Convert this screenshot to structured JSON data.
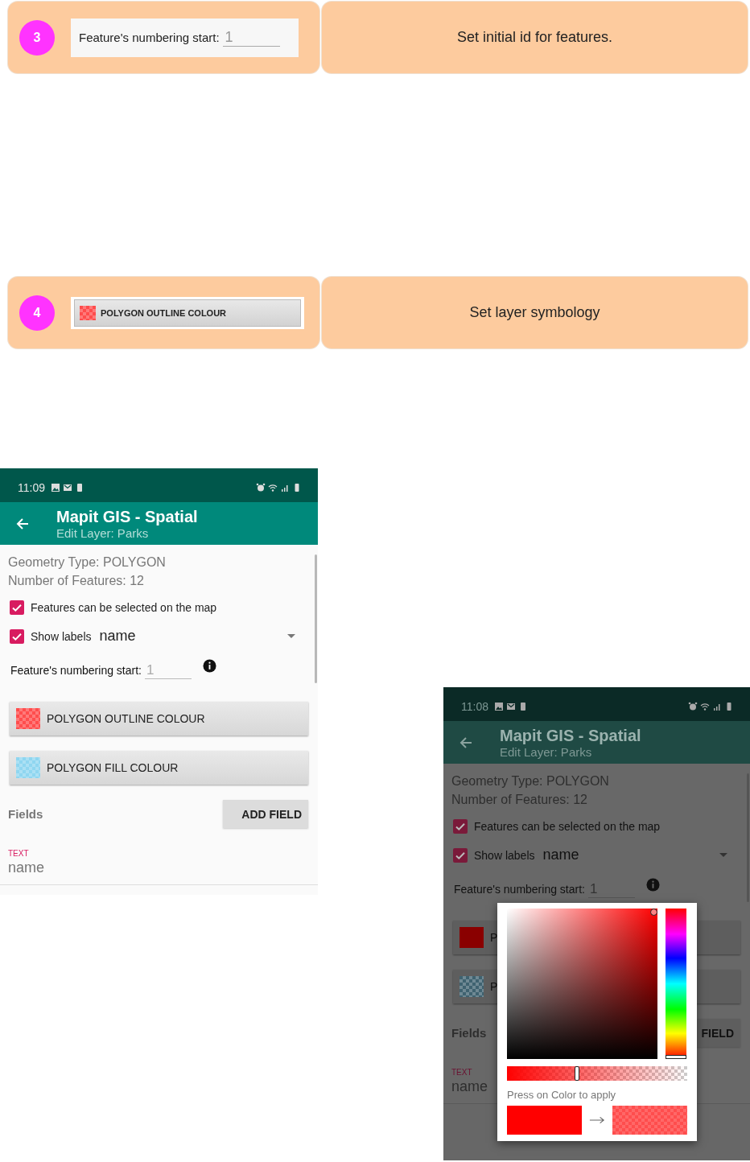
{
  "steps": [
    {
      "number": "3",
      "kind": "numbering",
      "label": "Feature's numbering start:",
      "placeholder": "1",
      "description": "Set initial id for features."
    },
    {
      "number": "4",
      "kind": "colour_button",
      "label": "POLYGON OUTLINE COLOUR",
      "color": "#ff4d4d",
      "description": "Set layer symbology"
    }
  ],
  "phones": [
    {
      "dimmed": false,
      "time": "11:09",
      "title": "Mapit GIS - Spatial",
      "subtitle": "Edit Layer: Parks",
      "info": [
        "Geometry Type: POLYGON",
        "Number of Features: 12"
      ],
      "checkboxes": [
        {
          "label": "Features can be selected on the map",
          "checked": true
        },
        {
          "label": "Show labels",
          "checked": true,
          "value": "name"
        }
      ],
      "numbering": {
        "label": "Feature's numbering start:",
        "placeholder": "1"
      },
      "colour_buttons": [
        {
          "label": "POLYGON OUTLINE COLOUR",
          "color": "#ff4d4d",
          "pattern": true
        },
        {
          "label": "POLYGON FILL COLOUR",
          "color": "#8fd6f0",
          "pattern": true
        }
      ],
      "fields_heading": "Fields",
      "add_field_button": "ADD FIELD",
      "field": {
        "type": "TEXT",
        "name": "name"
      }
    },
    {
      "dimmed": true,
      "time": "11:08",
      "title": "Mapit GIS - Spatial",
      "subtitle": "Edit Layer: Parks",
      "info": [
        "Geometry Type: POLYGON",
        "Number of Features: 12"
      ],
      "checkboxes": [
        {
          "label": "Features can be selected on the map",
          "checked": true
        },
        {
          "label": "Show labels",
          "checked": true,
          "value": "name"
        }
      ],
      "numbering": {
        "label": "Feature's numbering start:",
        "placeholder": "1"
      },
      "colour_buttons": [
        {
          "label": "P",
          "color": "#8a0000",
          "pattern": false
        },
        {
          "label": "P",
          "color": "#3f6270",
          "pattern": true
        }
      ],
      "fields_heading": "Fields",
      "add_field_button": "FIELD",
      "field": {
        "type": "TEXT",
        "name": "name"
      },
      "dialog": {
        "hue_slider": {
          "level": 0
        },
        "alpha_slider": {
          "level": 0.39
        },
        "hint": "Press on Color to apply"
      }
    }
  ]
}
